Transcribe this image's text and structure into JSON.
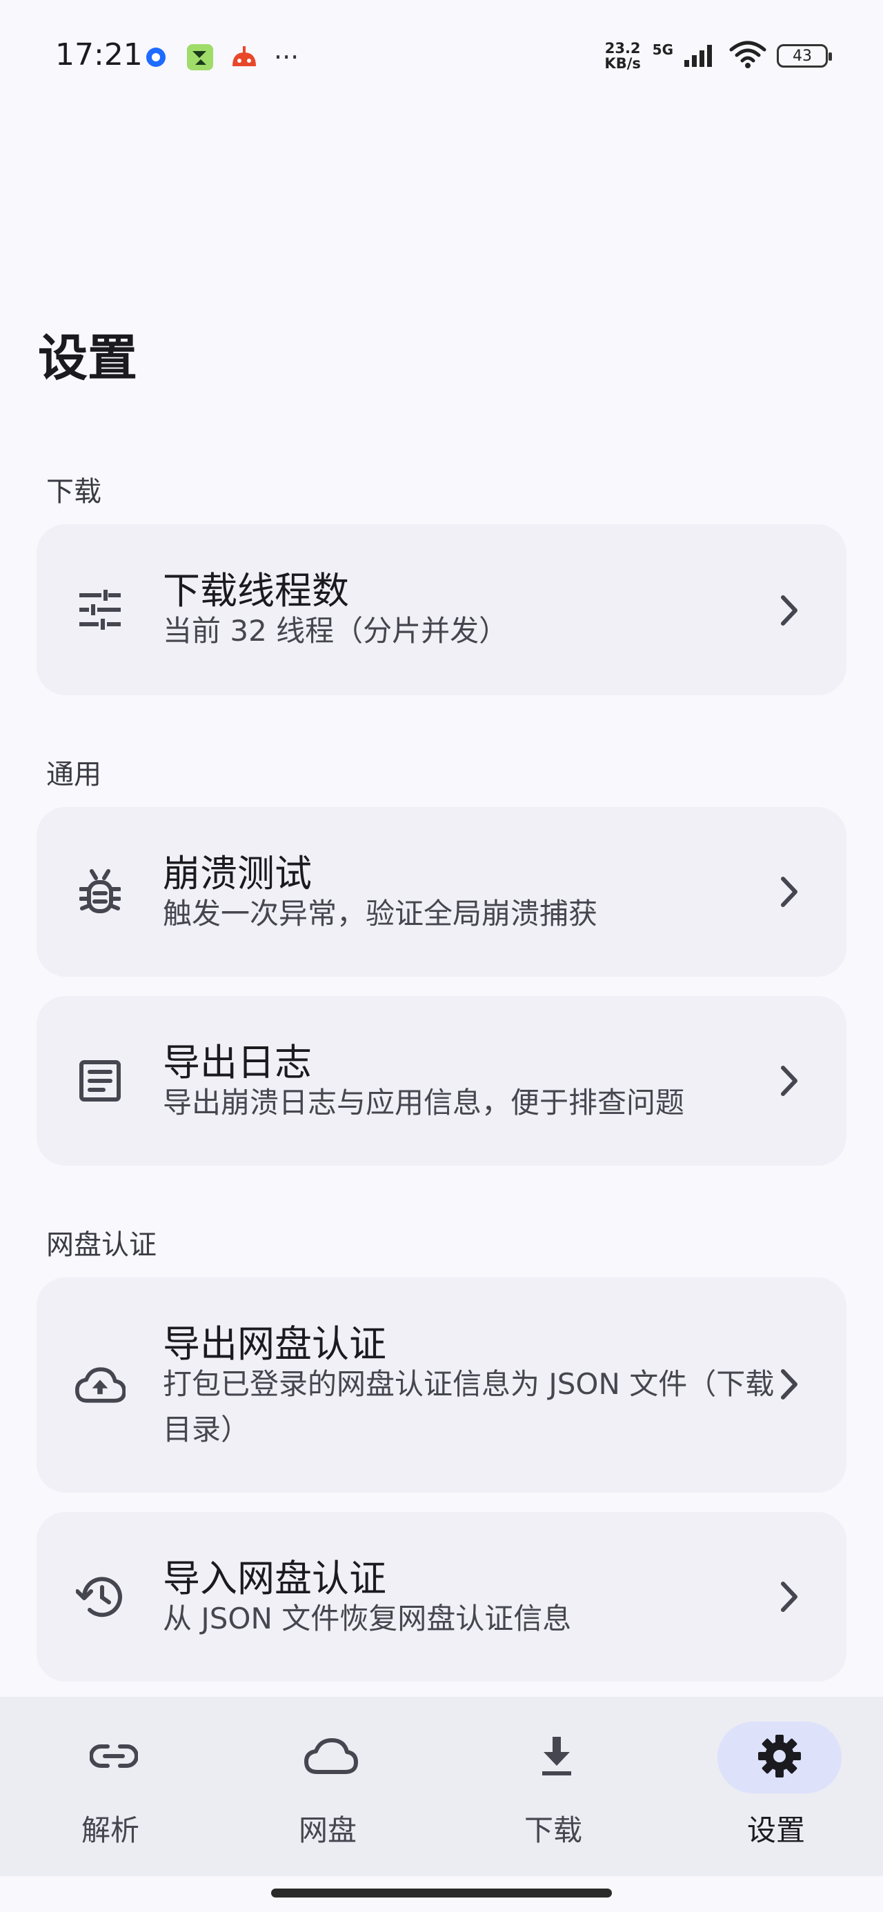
{
  "status_bar": {
    "time": "17:21",
    "net_speed_value": "23.2",
    "net_speed_unit": "KB/s",
    "net_type": "5G",
    "battery": "43",
    "more": "···"
  },
  "page": {
    "title": "设置"
  },
  "sections": {
    "download": {
      "label": "下载",
      "items": [
        {
          "title": "下载线程数",
          "subtitle": "当前 32 线程（分片并发）",
          "icon": "tune-icon"
        }
      ]
    },
    "general": {
      "label": "通用",
      "items": [
        {
          "title": "崩溃测试",
          "subtitle": "触发一次异常，验证全局崩溃捕获",
          "icon": "bug-icon"
        },
        {
          "title": "导出日志",
          "subtitle": "导出崩溃日志与应用信息，便于排查问题",
          "icon": "document-icon"
        }
      ]
    },
    "cloud_auth": {
      "label": "网盘认证",
      "items": [
        {
          "title": "导出网盘认证",
          "subtitle": "打包已登录的网盘认证信息为 JSON 文件（下载目录）",
          "icon": "cloud-upload-icon"
        },
        {
          "title": "导入网盘认证",
          "subtitle": "从 JSON 文件恢复网盘认证信息",
          "icon": "restore-history-icon"
        }
      ]
    }
  },
  "bottom_nav": {
    "items": [
      {
        "label": "解析",
        "icon": "link-icon",
        "active": false
      },
      {
        "label": "网盘",
        "icon": "cloud-icon",
        "active": false
      },
      {
        "label": "下载",
        "icon": "download-icon",
        "active": false
      },
      {
        "label": "设置",
        "icon": "gear-icon",
        "active": true
      }
    ]
  },
  "colors": {
    "background": "#f8f8fd",
    "card": "#f0f0f6",
    "nav_bar": "#ececf3",
    "active_pill": "#dde1fa",
    "text_primary": "#1b1b1f",
    "text_secondary": "#45464f"
  }
}
